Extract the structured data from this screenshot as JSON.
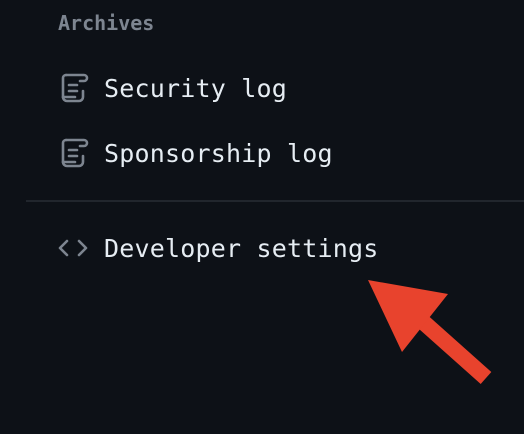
{
  "sidebar": {
    "archives_heading": "Archives",
    "items": [
      {
        "label": "Security log",
        "icon": "log-icon"
      },
      {
        "label": "Sponsorship log",
        "icon": "log-icon"
      },
      {
        "label": "Developer settings",
        "icon": "code-icon"
      }
    ]
  },
  "annotation": {
    "arrow_color": "#e8432d",
    "arrow_target": "Developer settings"
  },
  "colors": {
    "background": "#0d1117",
    "text": "#e6edf3",
    "muted": "#7d8590",
    "divider": "#21262d"
  }
}
